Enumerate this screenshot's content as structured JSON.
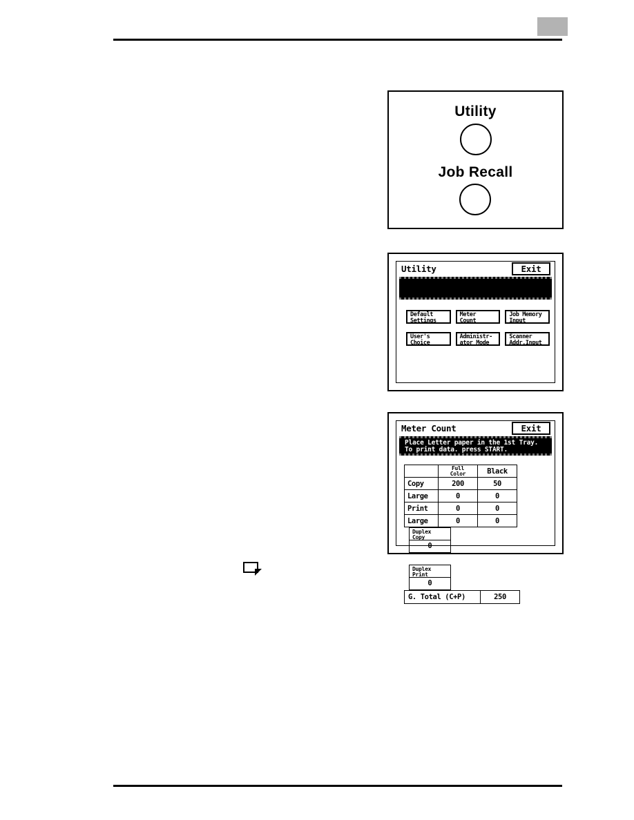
{
  "page": {
    "corner_mark_color": "#b3b3b3",
    "rule_color": "#000000"
  },
  "hardkeys_panel": {
    "keys": [
      {
        "label": "Utility",
        "shape": "circle-button"
      },
      {
        "label": "Job Recall",
        "shape": "circle-button"
      }
    ]
  },
  "utility_screen": {
    "title": "Utility",
    "exit_label": "Exit",
    "message_lines": [
      "",
      ""
    ],
    "buttons": [
      {
        "line1": "Default",
        "line2": "Settings"
      },
      {
        "line1": "Meter",
        "line2": "Count"
      },
      {
        "line1": "Job Memory",
        "line2": "Input"
      },
      {
        "line1": "User's",
        "line2": "Choice"
      },
      {
        "line1": "Administr-",
        "line2": "ator Mode"
      },
      {
        "line1": "Scanner",
        "line2": "Addr.Input"
      }
    ]
  },
  "meter_screen": {
    "title": "Meter Count",
    "exit_label": "Exit",
    "message_lines": [
      "Place Letter  paper in the 1st Tray.",
      "To print data. press START."
    ],
    "table": {
      "headers": [
        "",
        "Full\nColor",
        "Black"
      ],
      "header_blank": "",
      "header_full_color_line1": "Full",
      "header_full_color_line2": "Color",
      "header_black": "Black",
      "rows": [
        {
          "label": "Copy",
          "full_color": "200",
          "black": "50"
        },
        {
          "label": "Large",
          "full_color": "0",
          "black": "0"
        },
        {
          "label": "Print",
          "full_color": "0",
          "black": "0"
        },
        {
          "label": "Large",
          "full_color": "0",
          "black": "0"
        }
      ]
    },
    "duplex_copy": {
      "head_line1": "Duplex",
      "head_line2": "Copy",
      "value": "0"
    },
    "duplex_print": {
      "head_line1": "Duplex",
      "head_line2": "Print",
      "value": "0"
    },
    "grand_total": {
      "label": "G. Total  (C+P)",
      "value": "250"
    }
  }
}
